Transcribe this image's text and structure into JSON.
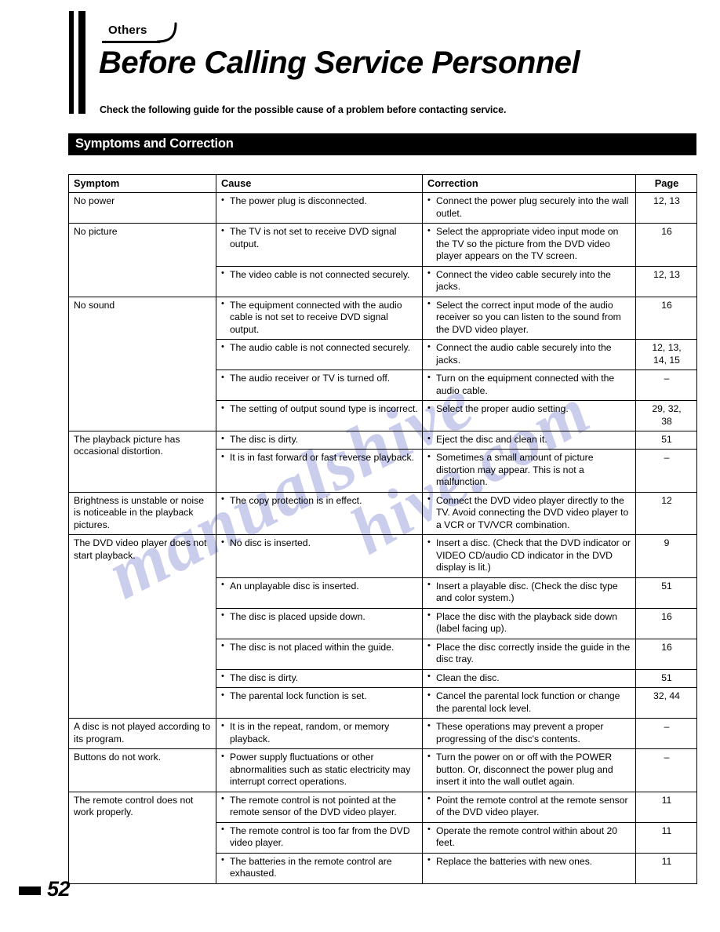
{
  "header": {
    "category_tag": "Others",
    "title": "Before Calling Service Personnel",
    "subtitle": "Check the following guide for the possible cause of a problem before contacting service."
  },
  "section": {
    "banner_title": "Symptoms and Correction"
  },
  "table": {
    "columns": {
      "symptom": "Symptom",
      "cause": "Cause",
      "correction": "Correction",
      "page": "Page"
    },
    "rows": [
      {
        "symptom": "No power",
        "symptom_rowspan": 1,
        "cause": "The power plug is disconnected.",
        "correction": "Connect the power plug securely into the wall outlet.",
        "page": "12, 13"
      },
      {
        "symptom": "No picture",
        "symptom_rowspan": 2,
        "cause": "The TV is not set to receive DVD signal output.",
        "correction": "Select the appropriate video input mode on the TV so the picture from the DVD video player appears on the TV screen.",
        "page": "16"
      },
      {
        "symptom": null,
        "cause": "The video cable is not connected securely.",
        "correction": "Connect the video cable securely into the jacks.",
        "page": "12, 13"
      },
      {
        "symptom": "No sound",
        "symptom_rowspan": 4,
        "cause": "The equipment connected with the audio cable is not set to receive DVD signal output.",
        "correction": "Select the correct input mode of the audio receiver so you can listen to the sound from the DVD video player.",
        "page": "16"
      },
      {
        "symptom": null,
        "cause": "The audio cable is not connected securely.",
        "correction": "Connect the audio cable securely into the jacks.",
        "page": "12, 13,\n14, 15"
      },
      {
        "symptom": null,
        "cause": "The audio receiver or TV is turned off.",
        "correction": "Turn on the equipment connected with the audio cable.",
        "page": "–"
      },
      {
        "symptom": null,
        "cause": "The setting of output sound type is incorrect.",
        "correction": "Select the proper audio setting.",
        "page": "29, 32,\n38"
      },
      {
        "symptom": "The playback picture has occasional distortion.",
        "symptom_rowspan": 2,
        "cause": "The disc is dirty.",
        "correction": "Eject the disc and clean it.",
        "page": "51"
      },
      {
        "symptom": null,
        "cause": "It is in fast forward or fast reverse playback.",
        "correction": "Sometimes a small amount of picture distortion may appear. This is not a malfunction.",
        "page": "–"
      },
      {
        "symptom": "Brightness is unstable or noise is noticeable in the playback pictures.",
        "symptom_rowspan": 1,
        "cause": "The copy protection is in effect.",
        "correction": "Connect the DVD video player directly to the TV.  Avoid connecting the DVD video player to a VCR or TV/VCR combination.",
        "page": "12"
      },
      {
        "symptom": "The DVD video player does not start playback.",
        "symptom_rowspan": 6,
        "cause": "No disc is inserted.",
        "correction": "Insert a disc. (Check that the DVD indicator or VIDEO CD/audio CD indicator in the DVD display is lit.)",
        "page": "9"
      },
      {
        "symptom": null,
        "cause": "An unplayable disc is inserted.",
        "correction": "Insert a playable disc. (Check the disc type and color system.)",
        "page": "51"
      },
      {
        "symptom": null,
        "cause": "The disc is placed upside down.",
        "correction": "Place the disc with the playback side down (label facing up).",
        "page": "16"
      },
      {
        "symptom": null,
        "cause": "The disc is not placed within the guide.",
        "correction": "Place the disc correctly inside the guide in the disc tray.",
        "page": "16"
      },
      {
        "symptom": null,
        "cause": "The disc is dirty.",
        "correction": "Clean the disc.",
        "page": "51"
      },
      {
        "symptom": null,
        "cause": "The parental lock function is set.",
        "correction": "Cancel the parental lock function or change the parental lock level.",
        "page": "32, 44"
      },
      {
        "symptom": "A disc is not played according to its program.",
        "symptom_rowspan": 1,
        "cause": "It is in the repeat, random, or memory playback.",
        "correction": "These operations may prevent a proper progressing of the disc's contents.",
        "page": "–"
      },
      {
        "symptom": "Buttons do not work.",
        "symptom_rowspan": 1,
        "cause": "Power supply fluctuations or other abnormalities such as static electricity may interrupt correct operations.",
        "correction": "Turn the power on or off with the POWER button. Or, disconnect the power plug and insert it into the wall outlet again.",
        "page": "–"
      },
      {
        "symptom": "The remote control does not work properly.",
        "symptom_rowspan": 3,
        "cause": "The remote control is not pointed at the remote sensor of the DVD video player.",
        "correction": "Point the remote control at the remote sensor of the DVD video player.",
        "page": "11"
      },
      {
        "symptom": null,
        "cause": "The remote control is too far from the DVD video player.",
        "correction": "Operate the remote control within about 20 feet.",
        "page": "11"
      },
      {
        "symptom": null,
        "cause": "The batteries in the remote control are exhausted.",
        "correction": "Replace the batteries with new ones.",
        "page": "11"
      }
    ]
  },
  "footer": {
    "page_number": "52"
  },
  "watermark": {
    "text_a": "manualshive",
    "text_b": "hive.com"
  },
  "colors": {
    "ink": "#000000",
    "banner_background": "#000000",
    "banner_text": "#ffffff",
    "watermark": "#b9bee6",
    "page_background": "#ffffff"
  }
}
